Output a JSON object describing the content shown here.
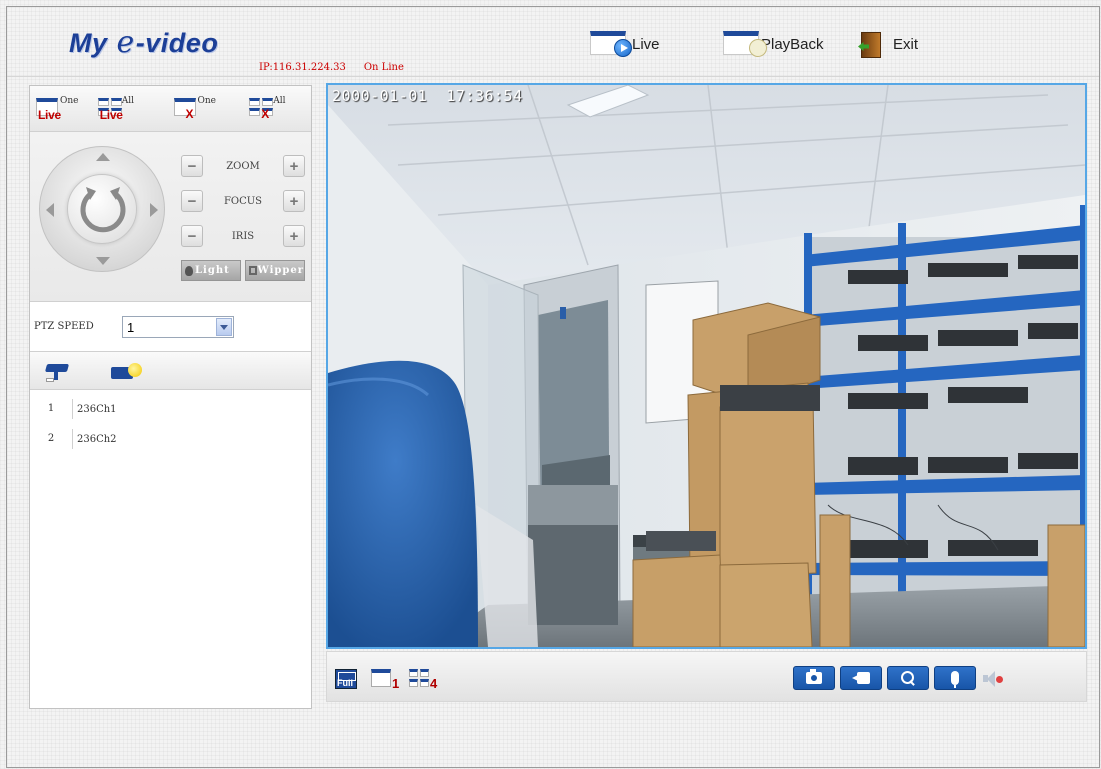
{
  "header": {
    "logo_prefix": "My",
    "logo_e": "e",
    "logo_suffix": "-video",
    "ip": "IP:116.31.224.33",
    "status": "On Line",
    "live_label": "Live",
    "playback_label": "PlayBack",
    "exit_label": "Exit"
  },
  "toolbar": {
    "one_live_sup": "One",
    "one_live_sub": "Live",
    "all_live_sup": "All",
    "all_live_sub": "Live",
    "close_one_sup": "One",
    "close_all_sup": "All",
    "close_mark": "X"
  },
  "ptz": {
    "zoom_label": "ZOOM",
    "focus_label": "FOCUS",
    "iris_label": "IRIS",
    "light_label": "Light",
    "wipper_label": "Wipper",
    "minus": "−",
    "plus": "+"
  },
  "speed": {
    "label": "PTZ SPEED",
    "value": "1"
  },
  "channels": [
    {
      "num": "1",
      "name": "236Ch1"
    },
    {
      "num": "2",
      "name": "236Ch2"
    }
  ],
  "video": {
    "osd_timestamp": "2000-01-01  17:36:54"
  },
  "bottom": {
    "full_label": "Full",
    "one_label": "1",
    "four_label": "4"
  },
  "colors": {
    "brand_blue": "#1f4a9a",
    "status_red": "#cc0000",
    "video_border": "#56a7e6"
  }
}
